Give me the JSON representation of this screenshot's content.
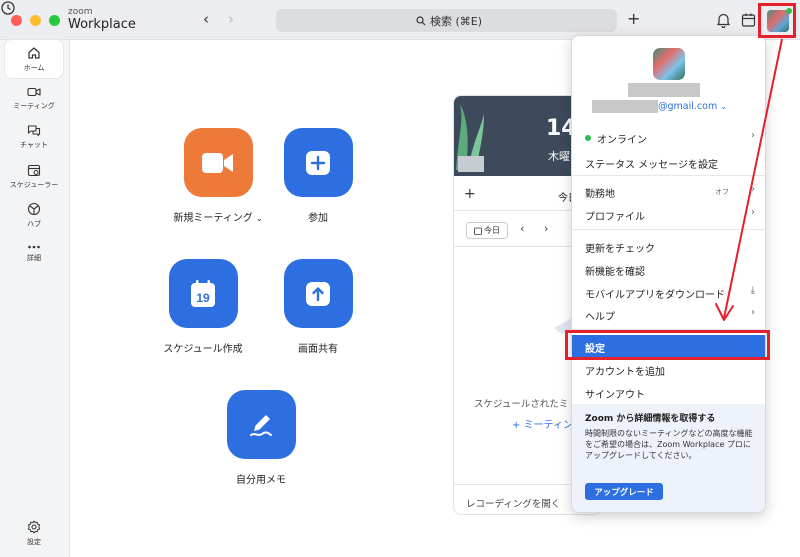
{
  "brand": {
    "small": "zoom",
    "name": "Workplace"
  },
  "search": {
    "label": "検索 (⌘E)"
  },
  "sidebar": {
    "items": [
      {
        "label": "ホーム"
      },
      {
        "label": "ミーティング"
      },
      {
        "label": "チャット"
      },
      {
        "label": "スケジューラー"
      },
      {
        "label": "ハブ"
      },
      {
        "label": "詳細"
      }
    ],
    "settings_label": "設定"
  },
  "actions": {
    "new_meeting": "新規ミーティング",
    "join": "参加",
    "schedule": "スケジュール作成",
    "share_screen": "画面共有",
    "memo": "自分用メモ",
    "calendar_icon_day": "19"
  },
  "calendar_card": {
    "time_fragment": "14",
    "day_fragment": "木曜",
    "today_fragment": "今日",
    "today_button": "今日",
    "empty_text": "スケジュールされたミ",
    "meeting_link": "ミーティン",
    "recording_text": "レコーディングを開く"
  },
  "menu": {
    "email_suffix": "@gmail.com",
    "status": "オンライン",
    "set_status": "ステータス メッセージを設定",
    "work_location": "勤務地",
    "work_location_value": "オフ",
    "profile": "プロファイル",
    "check_updates": "更新をチェック",
    "whats_new": "新機能を確認",
    "download_mobile": "モバイルアプリをダウンロード",
    "help": "ヘルプ",
    "settings": "設定",
    "add_account": "アカウントを追加",
    "sign_out": "サインアウト",
    "upgrade_title": "Zoom から詳細情報を取得する",
    "upgrade_body": "時間制限のないミーティングなどの高度な機能をご希望の場合は、Zoom Workplace プロにアップグレードしてください。",
    "upgrade_button": "アップグレード"
  },
  "colors": {
    "accent": "#2d6fe0",
    "orange_tile": "#ee7a3a",
    "annotation_red": "#e3202b",
    "online_green": "#2ebd4e"
  }
}
